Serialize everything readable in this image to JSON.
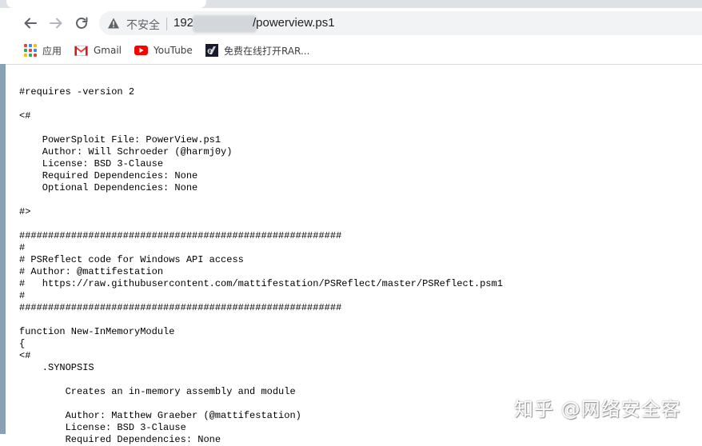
{
  "browser": {
    "security_label": "不安全",
    "url_host_visible": "192",
    "url_path": "/powerview.ps1"
  },
  "bookmarks": [
    {
      "label": "应用",
      "icon": "apps-grid-icon"
    },
    {
      "label": "Gmail",
      "icon": "gmail-icon"
    },
    {
      "label": "YouTube",
      "icon": "youtube-icon"
    },
    {
      "label": "免费在线打开RAR...",
      "icon": "rar-site-icon"
    }
  ],
  "document": {
    "lines": [
      "",
      "#requires -version 2",
      "",
      "<#",
      "",
      "    PowerSploit File: PowerView.ps1",
      "    Author: Will Schroeder (@harmj0y)",
      "    License: BSD 3-Clause",
      "    Required Dependencies: None",
      "    Optional Dependencies: None",
      "",
      "#>",
      "",
      "########################################################",
      "#",
      "# PSReflect code for Windows API access",
      "# Author: @mattifestation",
      "#   https://raw.githubusercontent.com/mattifestation/PSReflect/master/PSReflect.psm1",
      "#",
      "########################################################",
      "",
      "function New-InMemoryModule",
      "{",
      "<#",
      "    .SYNOPSIS",
      "",
      "        Creates an in-memory assembly and module",
      "",
      "        Author: Matthew Graeber (@mattifestation)",
      "        License: BSD 3-Clause",
      "        Required Dependencies: None"
    ]
  },
  "watermark": "知乎 @网络安全客"
}
